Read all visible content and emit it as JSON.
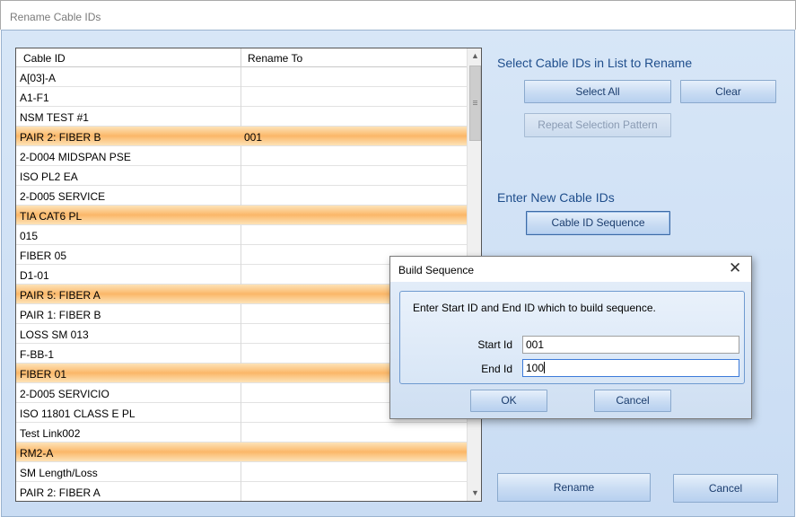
{
  "window": {
    "title": "Rename Cable IDs"
  },
  "grid": {
    "columns": [
      "Cable ID",
      "Rename To"
    ],
    "rows": [
      {
        "id": "A[03]-A",
        "rename": "",
        "highlight": false
      },
      {
        "id": "A1-F1",
        "rename": "",
        "highlight": false
      },
      {
        "id": "NSM TEST #1",
        "rename": "",
        "highlight": false
      },
      {
        "id": "PAIR 2: FIBER B",
        "rename": "001",
        "highlight": true
      },
      {
        "id": "2-D004 MIDSPAN PSE",
        "rename": "",
        "highlight": false
      },
      {
        "id": "ISO PL2 EA",
        "rename": "",
        "highlight": false
      },
      {
        "id": "2-D005 SERVICE",
        "rename": "",
        "highlight": false
      },
      {
        "id": "TIA CAT6 PL",
        "rename": "",
        "highlight": true
      },
      {
        "id": "015",
        "rename": "",
        "highlight": false
      },
      {
        "id": "FIBER 05",
        "rename": "",
        "highlight": false
      },
      {
        "id": "D1-01",
        "rename": "",
        "highlight": false
      },
      {
        "id": "PAIR 5: FIBER A",
        "rename": "",
        "highlight": true
      },
      {
        "id": "PAIR 1: FIBER B",
        "rename": "",
        "highlight": false
      },
      {
        "id": "LOSS SM 013",
        "rename": "",
        "highlight": false
      },
      {
        "id": "F-BB-1",
        "rename": "",
        "highlight": false
      },
      {
        "id": "FIBER 01",
        "rename": "",
        "highlight": true
      },
      {
        "id": "2-D005 SERVICIO",
        "rename": "",
        "highlight": false
      },
      {
        "id": "ISO 11801 CLASS E PL",
        "rename": "",
        "highlight": false
      },
      {
        "id": "Test Link002",
        "rename": "",
        "highlight": false
      },
      {
        "id": "RM2-A",
        "rename": "",
        "highlight": true
      },
      {
        "id": "SM Length/Loss",
        "rename": "",
        "highlight": false
      },
      {
        "id": "PAIR 2: FIBER A",
        "rename": "",
        "highlight": false
      }
    ]
  },
  "right_panel": {
    "select_label": "Select Cable IDs in List to Rename",
    "select_all": "Select All",
    "clear": "Clear",
    "repeat_pattern": "Repeat Selection Pattern",
    "enter_label": "Enter New Cable IDs",
    "sequence": "Cable ID Sequence",
    "rename": "Rename",
    "cancel": "Cancel"
  },
  "dialog": {
    "title": "Build Sequence",
    "close_glyph": "✕",
    "message": "Enter Start ID and End ID which to build sequence.",
    "start_label": "Start Id",
    "start_value": "001",
    "end_label": "End Id",
    "end_value": "100",
    "ok": "OK",
    "cancel": "Cancel"
  },
  "colors": {
    "highlight": "#fbb768",
    "label_blue": "#1f4e8c",
    "client_bg": "#d7e6f7"
  }
}
